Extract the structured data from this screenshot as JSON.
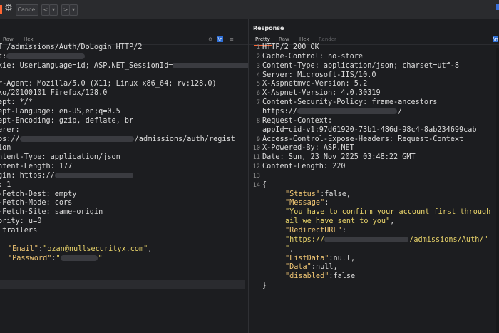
{
  "toolbar": {
    "cancel_label": "Cancel",
    "back_glyph": "<",
    "back_menu_glyph": "▾",
    "forward_glyph": ">",
    "forward_menu_glyph": "▾",
    "settings_icon": "gear-icon",
    "accent_color": "#ff6633"
  },
  "request": {
    "tabs": [
      "Raw",
      "Hex"
    ],
    "lines": [
      {
        "t": "T /admissions/Auth/DoLogin HTTP/2"
      },
      {
        "t": "t:",
        "blur": 110
      },
      {
        "t": "kie: UserLanguage=id; ASP.NET_SessionId=",
        "blur2": 120
      },
      {
        "t": ""
      },
      {
        "t": "r-Agent: Mozilla/5.0 (X11; Linux x86_64; rv:128.0)"
      },
      {
        "t": "ko/20100101 Firefox/128.0"
      },
      {
        "t": "ept: */*"
      },
      {
        "t": "ept-Language: en-US,en;q=0.5"
      },
      {
        "t": "ept-Encoding: gzip, deflate, br"
      },
      {
        "t": "erer:"
      },
      {
        "t": "ps://",
        "blur": 160,
        "after": "/admissions/auth/regist"
      },
      {
        "t": "ion"
      },
      {
        "t": "ntent-Type: application/json"
      },
      {
        "t": "ntent-Length: 177"
      },
      {
        "t": "gin: https://",
        "blur": 110
      },
      {
        "t": ": 1"
      },
      {
        "t": "-Fetch-Dest: empty"
      },
      {
        "t": "-Fetch-Mode: cors"
      },
      {
        "t": "-Fetch-Site: same-origin"
      },
      {
        "t": "ority: u=0"
      },
      {
        "t": " trailers"
      }
    ],
    "body": {
      "email_key": "\"Email\"",
      "email_val": "\"ozan@nullsecurityx.com\"",
      "password_key": "\"Password\"",
      "password_tail": "\""
    }
  },
  "response": {
    "title": "Response",
    "tabs": [
      "Pretty",
      "Raw",
      "Hex",
      "Render"
    ],
    "lines": [
      {
        "n": "1",
        "t": "HTTP/2 200 OK"
      },
      {
        "n": "2",
        "t": "Cache-Control: no-store"
      },
      {
        "n": "3",
        "t": "Content-Type: application/json; charset=utf-8"
      },
      {
        "n": "4",
        "t": "Server: Microsoft-IIS/10.0"
      },
      {
        "n": "5",
        "t": "X-Aspnetmvc-Version: 5.2"
      },
      {
        "n": "6",
        "t": "X-Aspnet-Version: 4.0.30319"
      },
      {
        "n": "7",
        "t": "Content-Security-Policy: frame-ancestors"
      },
      {
        "n": "",
        "t": "https://",
        "blur": 140,
        "after": "/"
      },
      {
        "n": "8",
        "t": "Request-Context:"
      },
      {
        "n": "",
        "t": "appId=cid-v1:97d61920-73b1-486d-98c4-8ab234699cab"
      },
      {
        "n": "9",
        "t": "Access-Control-Expose-Headers: Request-Context"
      },
      {
        "n": "10",
        "t": "X-Powered-By: ASP.NET"
      },
      {
        "n": "11",
        "t": "Date: Sun, 23 Nov 2025 03:48:22 GMT"
      },
      {
        "n": "12",
        "t": "Content-Length: 220"
      },
      {
        "n": "13",
        "t": ""
      },
      {
        "n": "14",
        "t": "{"
      }
    ],
    "json": {
      "status_key": "\"Status\"",
      "status_val": "false",
      "message_key": "\"Message\"",
      "message_val_1": "\"You have to confirm your account first through th",
      "message_val_2": "ail we have sent to you\"",
      "redirect_key": "\"RedirectURL\"",
      "redirect_val_start": "\"https://",
      "redirect_val_end": "/admissions/Auth/\"",
      "redirect_val_close": "\"",
      "listdata_key": "\"ListData\"",
      "listdata_val": "null",
      "data_key": "\"Data\"",
      "data_val": "null",
      "disabled_key": "\"disabled\"",
      "disabled_val": "false",
      "close_brace": "}"
    }
  }
}
